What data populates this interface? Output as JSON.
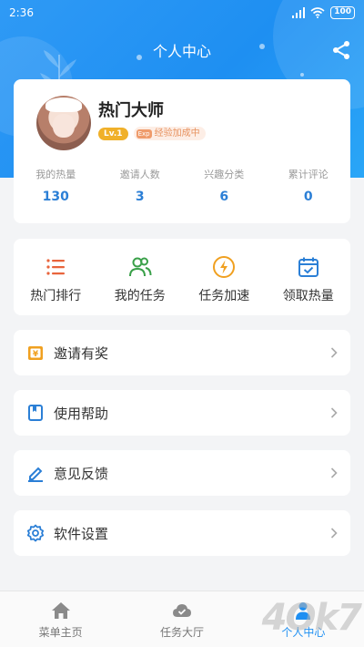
{
  "status_bar": {
    "time": "2:36",
    "battery": "100"
  },
  "header": {
    "title": "个人中心",
    "share_icon": "share-icon"
  },
  "profile": {
    "username": "热门大师",
    "level": "Lv.1",
    "exp_badge": "经验加成中",
    "exp_icon_text": "Exp",
    "stats": [
      {
        "label": "我的热量",
        "value": "130"
      },
      {
        "label": "邀请人数",
        "value": "3"
      },
      {
        "label": "兴趣分类",
        "value": "6"
      },
      {
        "label": "累计评论",
        "value": "0"
      }
    ]
  },
  "shortcuts": [
    {
      "label": "热门排行",
      "icon": "list-icon",
      "color": "#e8643c"
    },
    {
      "label": "我的任务",
      "icon": "users-icon",
      "color": "#3aa049"
    },
    {
      "label": "任务加速",
      "icon": "lightning-icon",
      "color": "#f0a020"
    },
    {
      "label": "领取热量",
      "icon": "calendar-check-icon",
      "color": "#2b7fd6"
    }
  ],
  "menu": [
    {
      "label": "邀请有奖",
      "icon": "gift-icon",
      "color": "#f0a020"
    },
    {
      "label": "使用帮助",
      "icon": "book-icon",
      "color": "#2b7fd6"
    },
    {
      "label": "意见反馈",
      "icon": "edit-icon",
      "color": "#2b7fd6"
    },
    {
      "label": "软件设置",
      "icon": "gear-icon",
      "color": "#2b7fd6"
    }
  ],
  "bottom_nav": [
    {
      "label": "菜单主页",
      "icon": "home-icon"
    },
    {
      "label": "任务大厅",
      "icon": "cloud-icon"
    },
    {
      "label": "个人中心",
      "icon": "person-icon",
      "active": true
    }
  ],
  "watermark": "4Ok7"
}
